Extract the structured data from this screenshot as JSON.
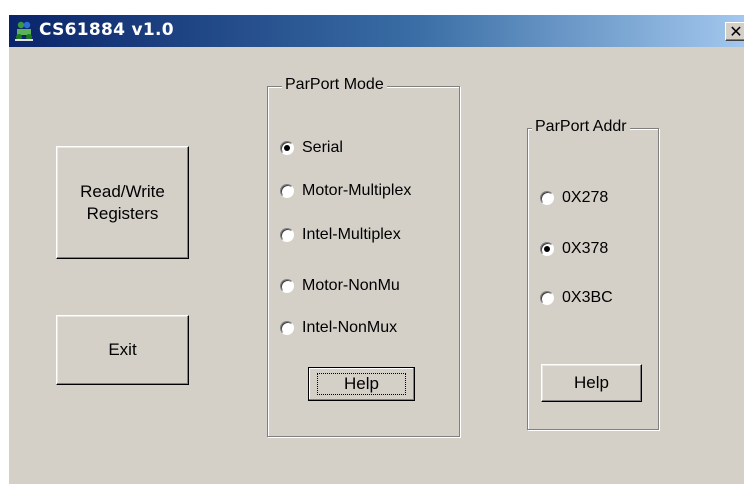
{
  "window": {
    "title": "CS61884 v1.0",
    "close_symbol": "✕"
  },
  "buttons": {
    "read_write": [
      "Read/Write",
      "Registers"
    ],
    "exit": "Exit"
  },
  "mode_group": {
    "title": "ParPort Mode",
    "options": [
      "Serial",
      "Motor-Multiplex",
      "Intel-Multiplex",
      "Motor-NonMu",
      "Intel-NonMux"
    ],
    "selected": "Serial",
    "help": "Help"
  },
  "addr_group": {
    "title": "ParPort Addr",
    "options": [
      "0X278",
      "0X378",
      "0X3BC"
    ],
    "selected": "0X378",
    "help": "Help"
  }
}
